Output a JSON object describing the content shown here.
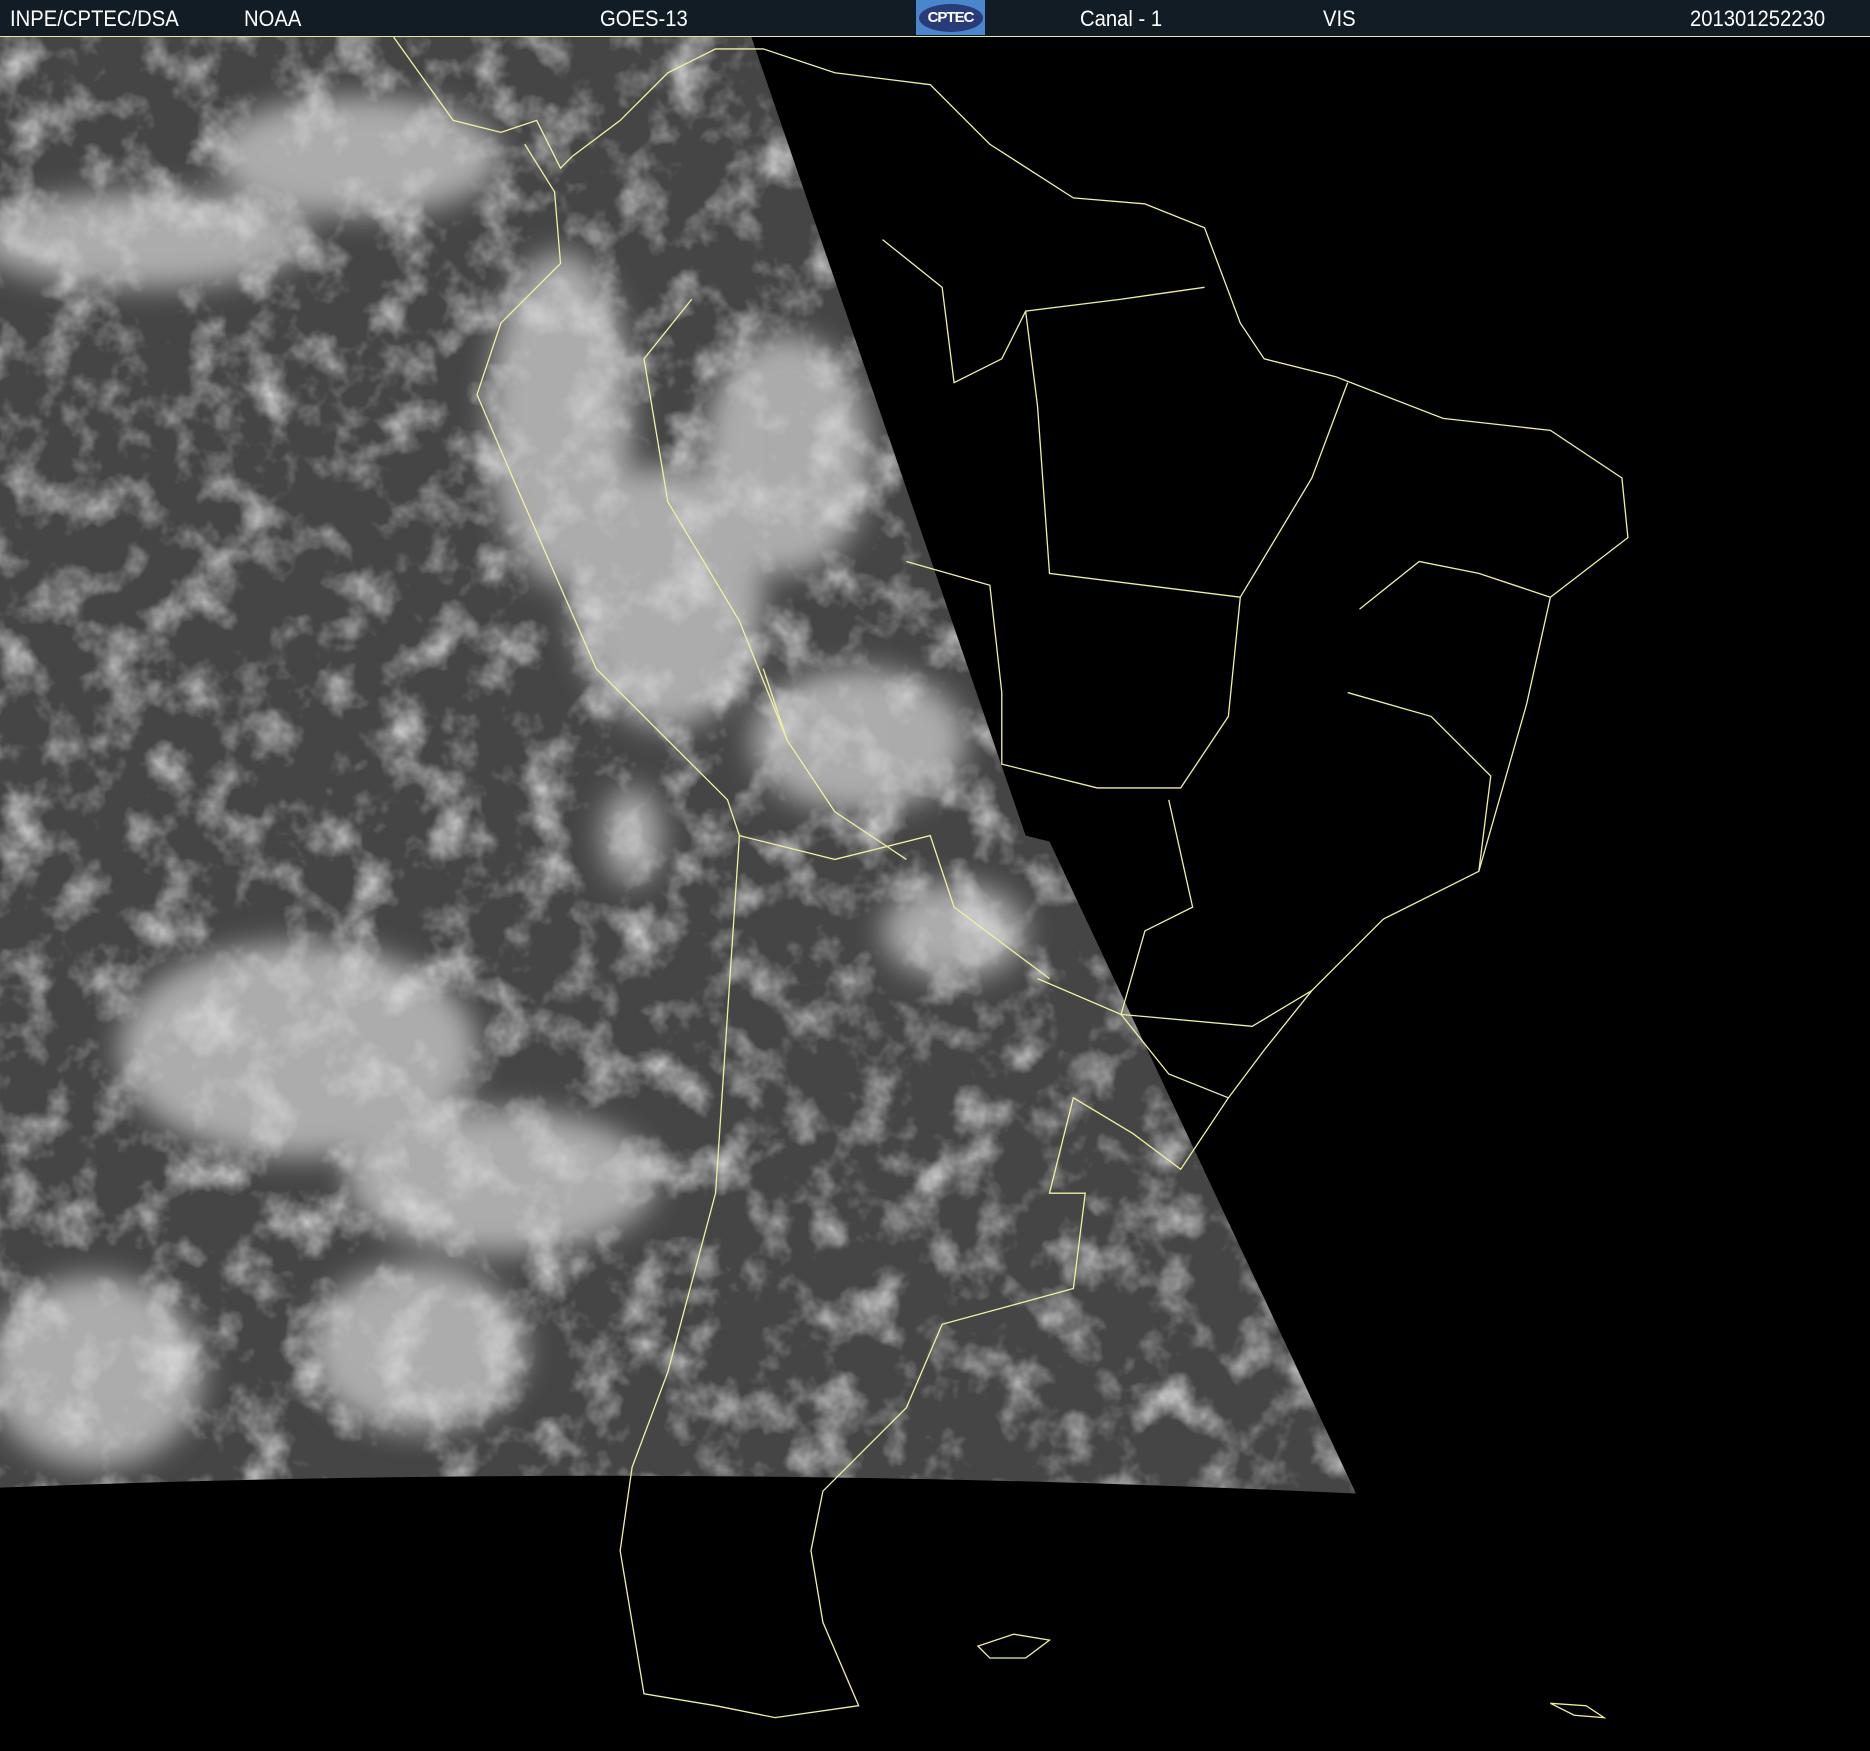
{
  "header": {
    "agency": "INPE/CPTEC/DSA",
    "source": "NOAA",
    "satellite": "GOES-13",
    "logo_text": "CPTEC",
    "channel": "Canal - 1",
    "band": "VIS",
    "timestamp": "201301252230"
  },
  "colors": {
    "header_bg": "#111c24",
    "outline": "#f0f0a0",
    "logo_bg": "#4a86cc"
  }
}
